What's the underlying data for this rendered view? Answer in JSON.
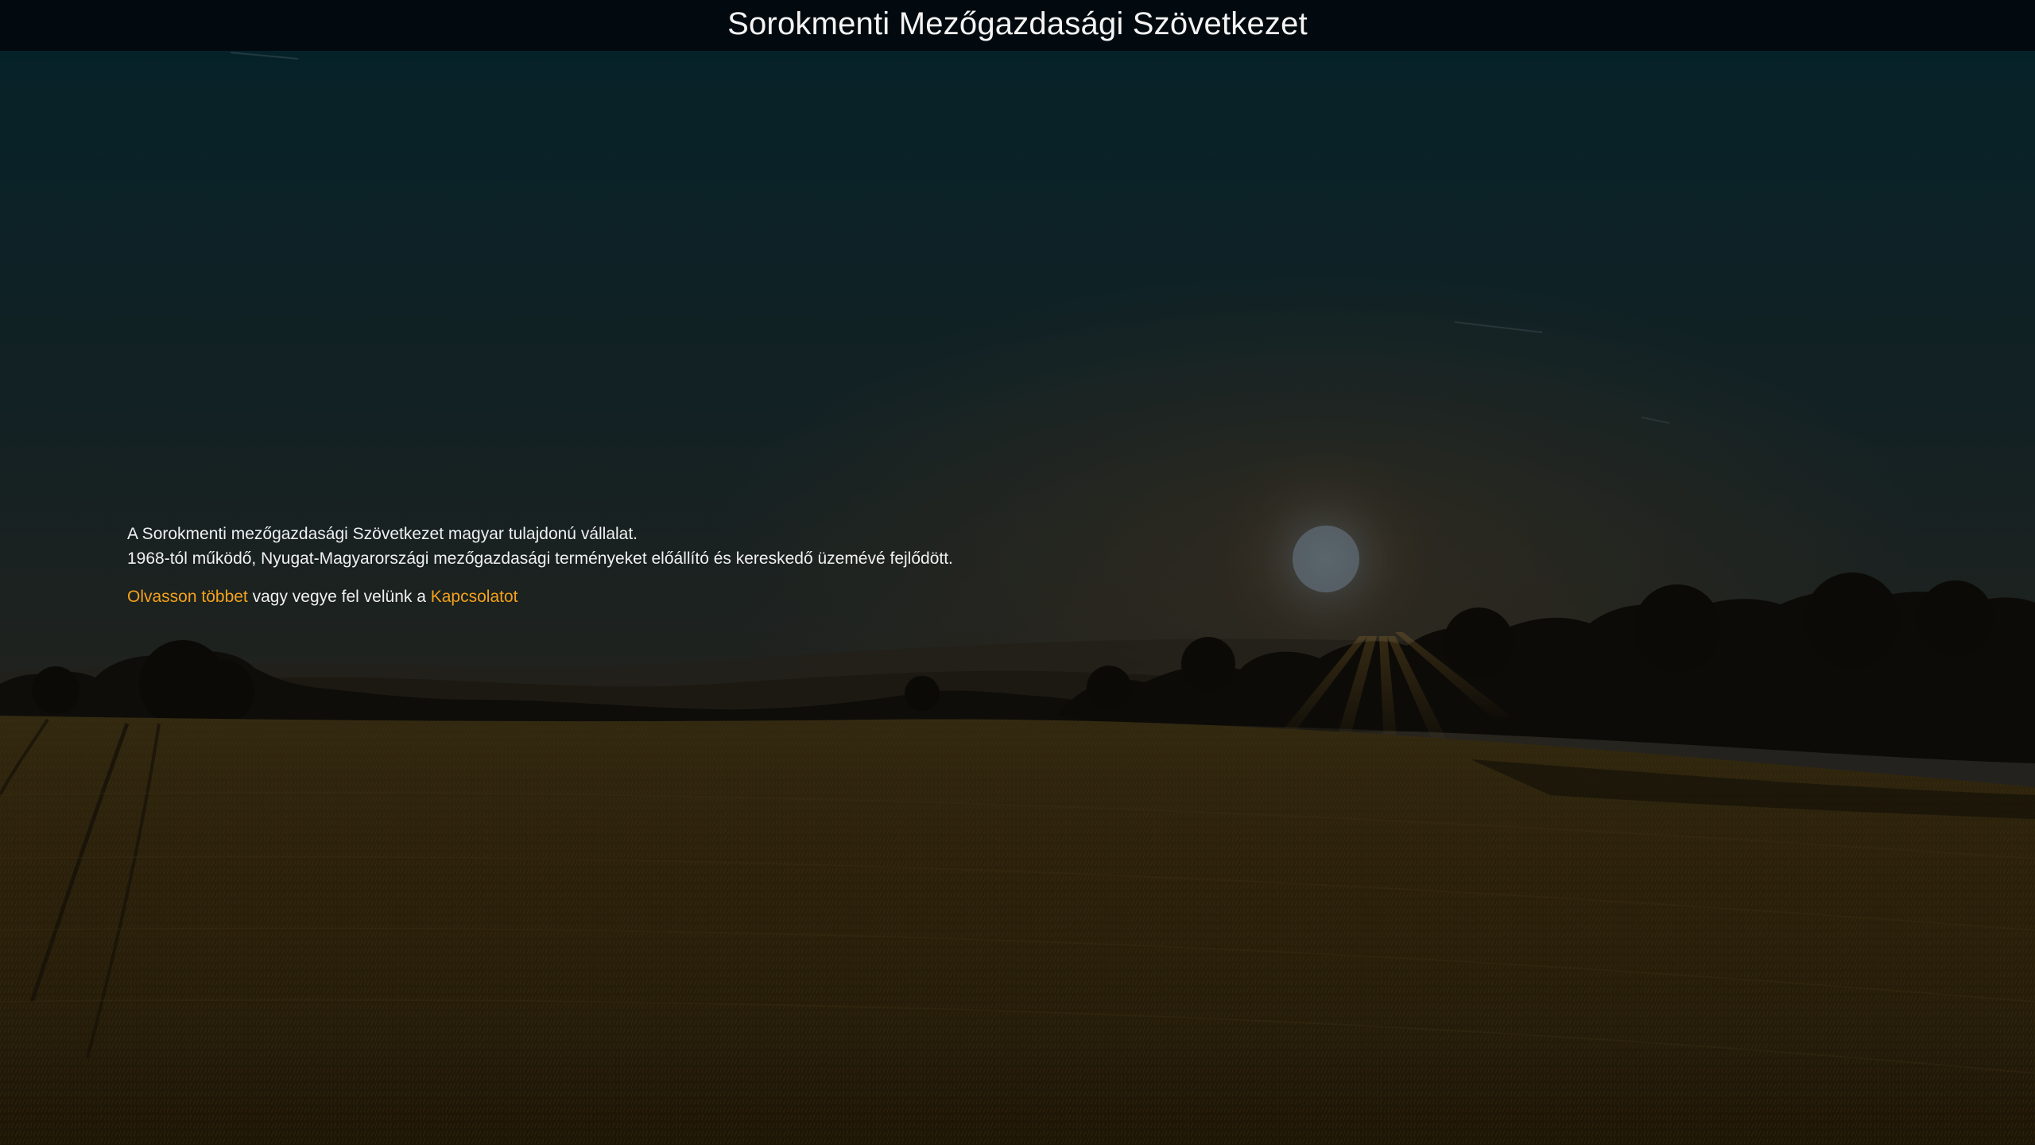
{
  "header": {
    "title": "Sorokmenti Mezőgazdasági Szövetkezet"
  },
  "intro": {
    "line1": "A Sorokmenti mezőgazdasági Szövetkezet magyar tulajdonú vállalat.",
    "line2": "1968-tól működő, Nyugat-Magyarországi mezőgazdasági terményeket előállító és kereskedő üzemévé fejlődött.",
    "read_more_link": "Olvasson többet",
    "middle_text": " vagy vegye fel velünk a ",
    "contact_link": "Kapcsolatot"
  },
  "colors": {
    "link": "#f5a21b",
    "header_bg": "#03090d",
    "text": "#f0f0f0"
  }
}
